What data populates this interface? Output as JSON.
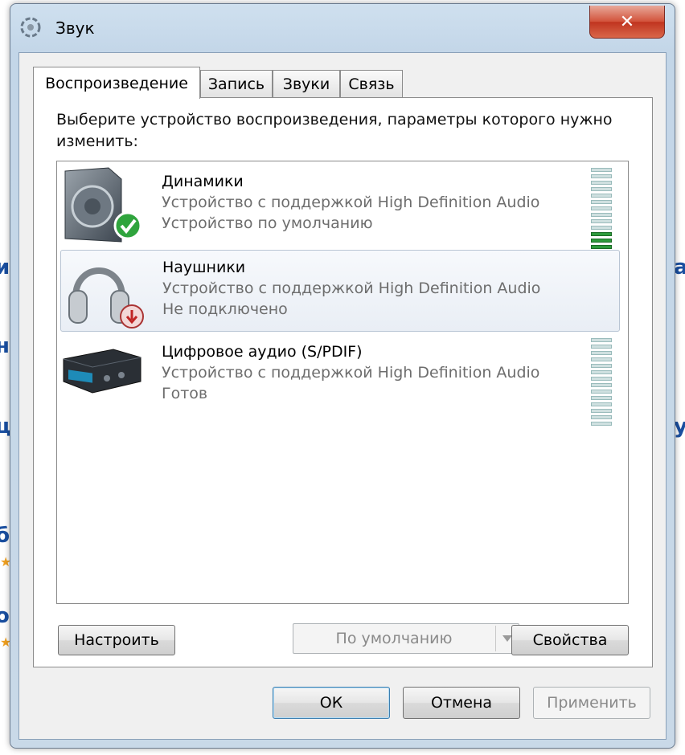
{
  "window": {
    "title": "Звук",
    "close_glyph": "✕"
  },
  "tabs": [
    {
      "label": "Воспроизведение",
      "active": true
    },
    {
      "label": "Запись",
      "active": false
    },
    {
      "label": "Звуки",
      "active": false
    },
    {
      "label": "Связь",
      "active": false
    }
  ],
  "panel": {
    "instruction": "Выберите устройство воспроизведения, параметры которого нужно изменить:",
    "devices": [
      {
        "name": "Динамики",
        "description": "Устройство с поддержкой High Definition Audio",
        "status": "Устройство по умолчанию",
        "icon": "speaker-icon",
        "badge": "default-check-icon",
        "selected": false,
        "meter_level": 0.3
      },
      {
        "name": "Наушники",
        "description": "Устройство с поддержкой High Definition Audio",
        "status": "Не подключено",
        "icon": "headphones-icon",
        "badge": "disconnected-icon",
        "selected": true,
        "meter_level": null
      },
      {
        "name": "Цифровое аудио (S/PDIF)",
        "description": "Устройство с поддержкой High Definition Audio",
        "status": "Готов",
        "icon": "digital-audio-receiver-icon",
        "badge": null,
        "selected": false,
        "meter_level": 0
      }
    ]
  },
  "buttons": {
    "configure": "Настроить",
    "set_default": "По умолчанию",
    "properties": "Свойства",
    "ok": "ОК",
    "cancel": "Отмена",
    "apply": "Применить"
  },
  "colors": {
    "meter_active": "#2e9a3c",
    "meter_inactive": "#cfe0e0",
    "close_button": "#c0341f"
  }
}
